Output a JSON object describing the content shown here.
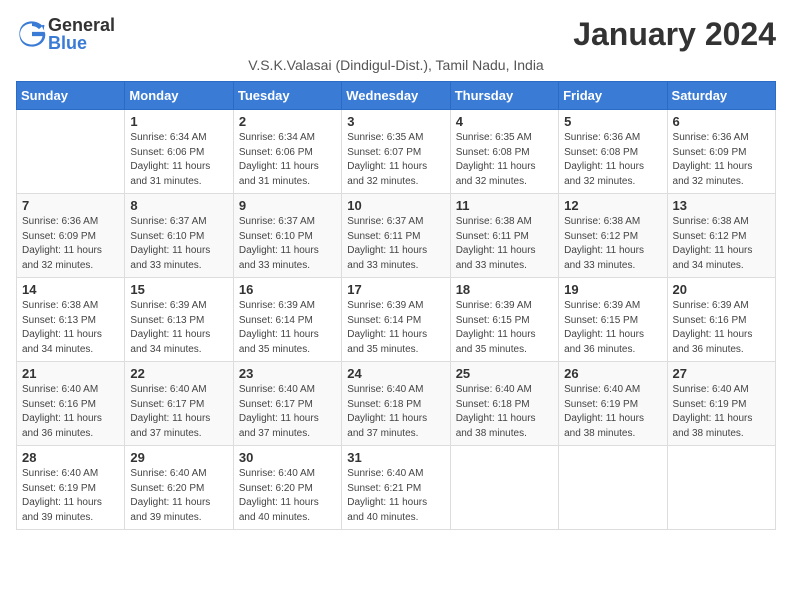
{
  "logo": {
    "general": "General",
    "blue": "Blue"
  },
  "title": "January 2024",
  "subtitle": "V.S.K.Valasai (Dindigul-Dist.), Tamil Nadu, India",
  "headers": [
    "Sunday",
    "Monday",
    "Tuesday",
    "Wednesday",
    "Thursday",
    "Friday",
    "Saturday"
  ],
  "weeks": [
    [
      {
        "day": "",
        "info": ""
      },
      {
        "day": "1",
        "info": "Sunrise: 6:34 AM\nSunset: 6:06 PM\nDaylight: 11 hours\nand 31 minutes."
      },
      {
        "day": "2",
        "info": "Sunrise: 6:34 AM\nSunset: 6:06 PM\nDaylight: 11 hours\nand 31 minutes."
      },
      {
        "day": "3",
        "info": "Sunrise: 6:35 AM\nSunset: 6:07 PM\nDaylight: 11 hours\nand 32 minutes."
      },
      {
        "day": "4",
        "info": "Sunrise: 6:35 AM\nSunset: 6:08 PM\nDaylight: 11 hours\nand 32 minutes."
      },
      {
        "day": "5",
        "info": "Sunrise: 6:36 AM\nSunset: 6:08 PM\nDaylight: 11 hours\nand 32 minutes."
      },
      {
        "day": "6",
        "info": "Sunrise: 6:36 AM\nSunset: 6:09 PM\nDaylight: 11 hours\nand 32 minutes."
      }
    ],
    [
      {
        "day": "7",
        "info": "Sunrise: 6:36 AM\nSunset: 6:09 PM\nDaylight: 11 hours\nand 32 minutes."
      },
      {
        "day": "8",
        "info": "Sunrise: 6:37 AM\nSunset: 6:10 PM\nDaylight: 11 hours\nand 33 minutes."
      },
      {
        "day": "9",
        "info": "Sunrise: 6:37 AM\nSunset: 6:10 PM\nDaylight: 11 hours\nand 33 minutes."
      },
      {
        "day": "10",
        "info": "Sunrise: 6:37 AM\nSunset: 6:11 PM\nDaylight: 11 hours\nand 33 minutes."
      },
      {
        "day": "11",
        "info": "Sunrise: 6:38 AM\nSunset: 6:11 PM\nDaylight: 11 hours\nand 33 minutes."
      },
      {
        "day": "12",
        "info": "Sunrise: 6:38 AM\nSunset: 6:12 PM\nDaylight: 11 hours\nand 33 minutes."
      },
      {
        "day": "13",
        "info": "Sunrise: 6:38 AM\nSunset: 6:12 PM\nDaylight: 11 hours\nand 34 minutes."
      }
    ],
    [
      {
        "day": "14",
        "info": "Sunrise: 6:38 AM\nSunset: 6:13 PM\nDaylight: 11 hours\nand 34 minutes."
      },
      {
        "day": "15",
        "info": "Sunrise: 6:39 AM\nSunset: 6:13 PM\nDaylight: 11 hours\nand 34 minutes."
      },
      {
        "day": "16",
        "info": "Sunrise: 6:39 AM\nSunset: 6:14 PM\nDaylight: 11 hours\nand 35 minutes."
      },
      {
        "day": "17",
        "info": "Sunrise: 6:39 AM\nSunset: 6:14 PM\nDaylight: 11 hours\nand 35 minutes."
      },
      {
        "day": "18",
        "info": "Sunrise: 6:39 AM\nSunset: 6:15 PM\nDaylight: 11 hours\nand 35 minutes."
      },
      {
        "day": "19",
        "info": "Sunrise: 6:39 AM\nSunset: 6:15 PM\nDaylight: 11 hours\nand 36 minutes."
      },
      {
        "day": "20",
        "info": "Sunrise: 6:39 AM\nSunset: 6:16 PM\nDaylight: 11 hours\nand 36 minutes."
      }
    ],
    [
      {
        "day": "21",
        "info": "Sunrise: 6:40 AM\nSunset: 6:16 PM\nDaylight: 11 hours\nand 36 minutes."
      },
      {
        "day": "22",
        "info": "Sunrise: 6:40 AM\nSunset: 6:17 PM\nDaylight: 11 hours\nand 37 minutes."
      },
      {
        "day": "23",
        "info": "Sunrise: 6:40 AM\nSunset: 6:17 PM\nDaylight: 11 hours\nand 37 minutes."
      },
      {
        "day": "24",
        "info": "Sunrise: 6:40 AM\nSunset: 6:18 PM\nDaylight: 11 hours\nand 37 minutes."
      },
      {
        "day": "25",
        "info": "Sunrise: 6:40 AM\nSunset: 6:18 PM\nDaylight: 11 hours\nand 38 minutes."
      },
      {
        "day": "26",
        "info": "Sunrise: 6:40 AM\nSunset: 6:19 PM\nDaylight: 11 hours\nand 38 minutes."
      },
      {
        "day": "27",
        "info": "Sunrise: 6:40 AM\nSunset: 6:19 PM\nDaylight: 11 hours\nand 38 minutes."
      }
    ],
    [
      {
        "day": "28",
        "info": "Sunrise: 6:40 AM\nSunset: 6:19 PM\nDaylight: 11 hours\nand 39 minutes."
      },
      {
        "day": "29",
        "info": "Sunrise: 6:40 AM\nSunset: 6:20 PM\nDaylight: 11 hours\nand 39 minutes."
      },
      {
        "day": "30",
        "info": "Sunrise: 6:40 AM\nSunset: 6:20 PM\nDaylight: 11 hours\nand 40 minutes."
      },
      {
        "day": "31",
        "info": "Sunrise: 6:40 AM\nSunset: 6:21 PM\nDaylight: 11 hours\nand 40 minutes."
      },
      {
        "day": "",
        "info": ""
      },
      {
        "day": "",
        "info": ""
      },
      {
        "day": "",
        "info": ""
      }
    ]
  ]
}
